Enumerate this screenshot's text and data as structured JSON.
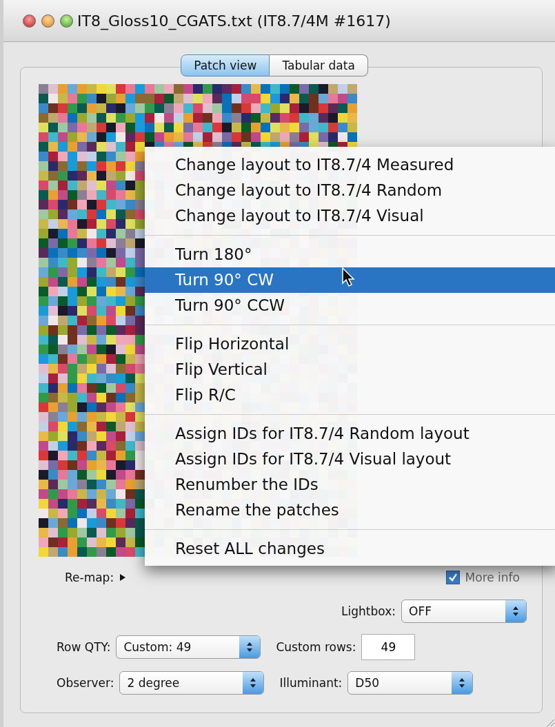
{
  "window": {
    "title": "IT8_Gloss10_CGATS.txt (IT8.7/4M #1617)"
  },
  "tabs": [
    {
      "label": "Patch view",
      "selected": true
    },
    {
      "label": "Tabular data",
      "selected": false
    }
  ],
  "menu": {
    "groups": [
      [
        {
          "label": "Change layout to IT8.7/4 Measured",
          "selected": false
        },
        {
          "label": "Change layout to IT8.7/4 Random",
          "selected": false
        },
        {
          "label": "Change layout to IT8.7/4 Visual",
          "selected": false
        }
      ],
      [
        {
          "label": "Turn 180°",
          "selected": false
        },
        {
          "label": "Turn 90° CW",
          "selected": true
        },
        {
          "label": "Turn 90° CCW",
          "selected": false
        }
      ],
      [
        {
          "label": "Flip Horizontal",
          "selected": false
        },
        {
          "label": "Flip Vertical",
          "selected": false
        },
        {
          "label": "Flip R/C",
          "selected": false
        }
      ],
      [
        {
          "label": "Assign IDs for IT8.7/4 Random layout",
          "selected": false
        },
        {
          "label": "Assign IDs for IT8.7/4 Visual layout",
          "selected": false
        },
        {
          "label": "Renumber the IDs",
          "selected": false
        },
        {
          "label": "Rename the patches",
          "selected": false
        }
      ],
      [
        {
          "label": "Reset ALL changes",
          "selected": false
        }
      ]
    ]
  },
  "remap": {
    "label": "Re-map:"
  },
  "more_info": {
    "label": "More info",
    "checked": true
  },
  "lightbox": {
    "label": "Lightbox:",
    "value": "OFF"
  },
  "row_qty": {
    "label": "Row QTY:",
    "value": "Custom: 49"
  },
  "custom_rows": {
    "label": "Custom rows:",
    "value": "49"
  },
  "observer": {
    "label": "Observer:",
    "value": "2 degree"
  },
  "illuminant": {
    "label": "Illuminant:",
    "value": "D50"
  }
}
